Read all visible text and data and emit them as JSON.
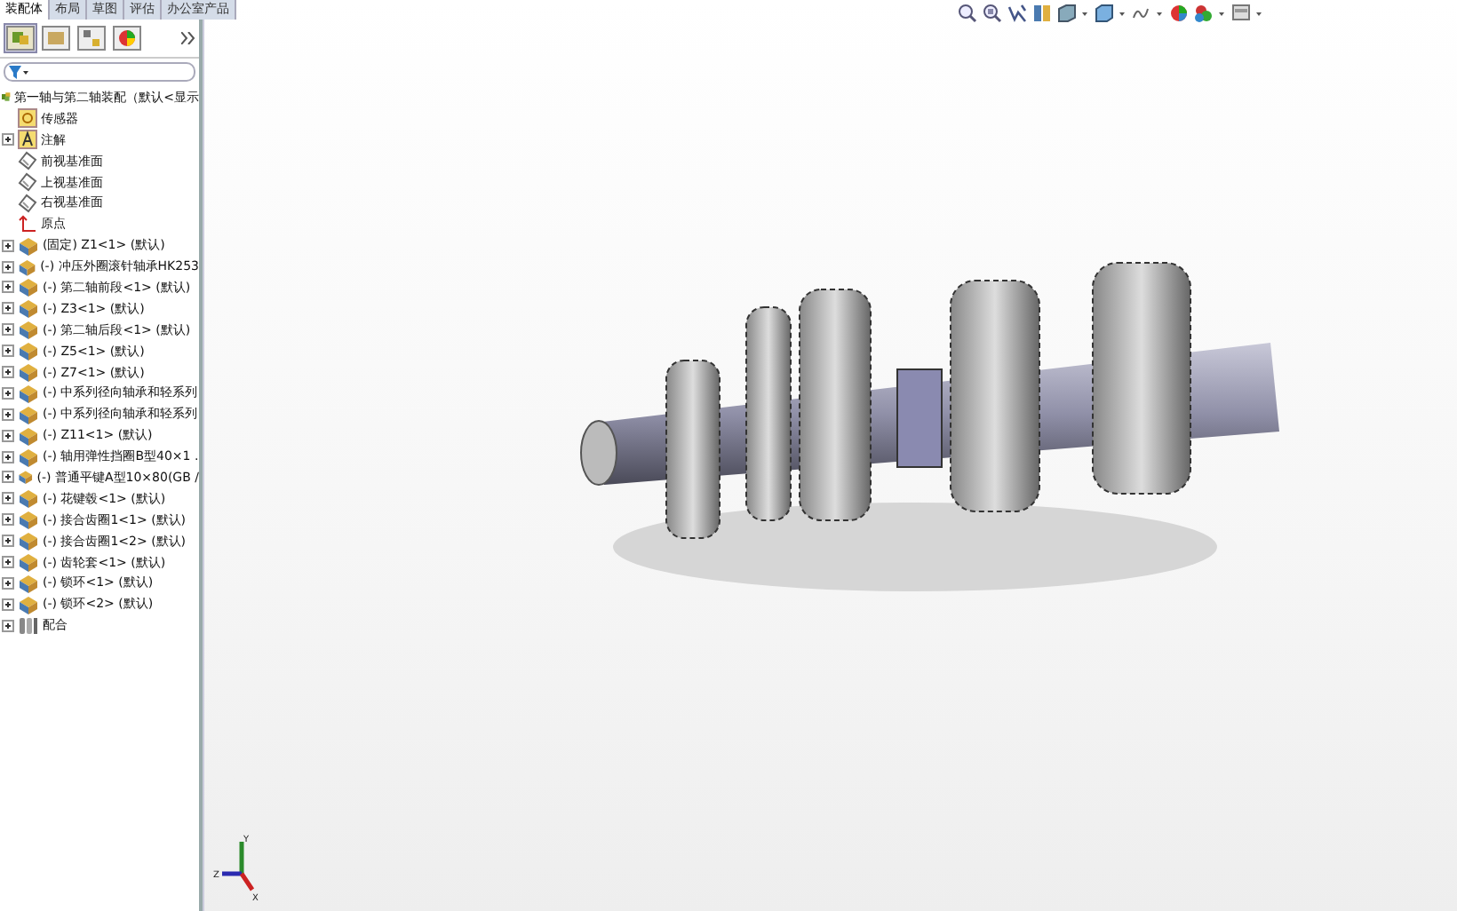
{
  "tabs": [
    {
      "label": "装配体",
      "selected": true
    },
    {
      "label": "布局",
      "selected": false
    },
    {
      "label": "草图",
      "selected": false
    },
    {
      "label": "评估",
      "selected": false
    },
    {
      "label": "办公室产品",
      "selected": false
    }
  ],
  "tree": {
    "label": "第一轴与第二轴装配（默认<显示",
    "children": [
      {
        "kind": "sensor",
        "label": "传感器",
        "expandable": false
      },
      {
        "kind": "annotation",
        "label": "注解",
        "expandable": true
      },
      {
        "kind": "plane",
        "label": "前视基准面",
        "expandable": false
      },
      {
        "kind": "plane",
        "label": "上视基准面",
        "expandable": false
      },
      {
        "kind": "plane",
        "label": "右视基准面",
        "expandable": false
      },
      {
        "kind": "origin",
        "label": "原点",
        "expandable": false
      },
      {
        "kind": "part",
        "label": "(固定) Z1<1> (默认)",
        "expandable": true
      },
      {
        "kind": "part",
        "label": "(-) 冲压外圈滚针轴承HK253",
        "expandable": true
      },
      {
        "kind": "part",
        "label": "(-) 第二轴前段<1> (默认)",
        "expandable": true
      },
      {
        "kind": "part",
        "label": "(-) Z3<1> (默认)",
        "expandable": true
      },
      {
        "kind": "part",
        "label": "(-) 第二轴后段<1> (默认)",
        "expandable": true
      },
      {
        "kind": "part",
        "label": "(-) Z5<1> (默认)",
        "expandable": true
      },
      {
        "kind": "part",
        "label": "(-) Z7<1> (默认)",
        "expandable": true
      },
      {
        "kind": "part",
        "label": "(-) 中系列径向轴承和轻系列",
        "expandable": true
      },
      {
        "kind": "part",
        "label": "(-) 中系列径向轴承和轻系列",
        "expandable": true
      },
      {
        "kind": "part",
        "label": "(-) Z11<1> (默认)",
        "expandable": true
      },
      {
        "kind": "part",
        "label": "(-) 轴用弹性挡圈B型40×1 .",
        "expandable": true
      },
      {
        "kind": "part",
        "label": "(-) 普通平键A型10×80(GB /",
        "expandable": true
      },
      {
        "kind": "part",
        "label": "(-) 花键毂<1> (默认)",
        "expandable": true
      },
      {
        "kind": "part",
        "label": "(-) 接合齿圈1<1> (默认)",
        "expandable": true
      },
      {
        "kind": "part",
        "label": "(-) 接合齿圈1<2> (默认)",
        "expandable": true
      },
      {
        "kind": "part",
        "label": "(-) 齿轮套<1> (默认)",
        "expandable": true
      },
      {
        "kind": "part",
        "label": "(-) 锁环<1> (默认)",
        "expandable": true
      },
      {
        "kind": "part",
        "label": "(-) 锁环<2> (默认)",
        "expandable": true
      },
      {
        "kind": "mates",
        "label": "配合",
        "expandable": true
      }
    ]
  },
  "triad": {
    "x_label": "X",
    "y_label": "Y",
    "z_label": "Z"
  }
}
